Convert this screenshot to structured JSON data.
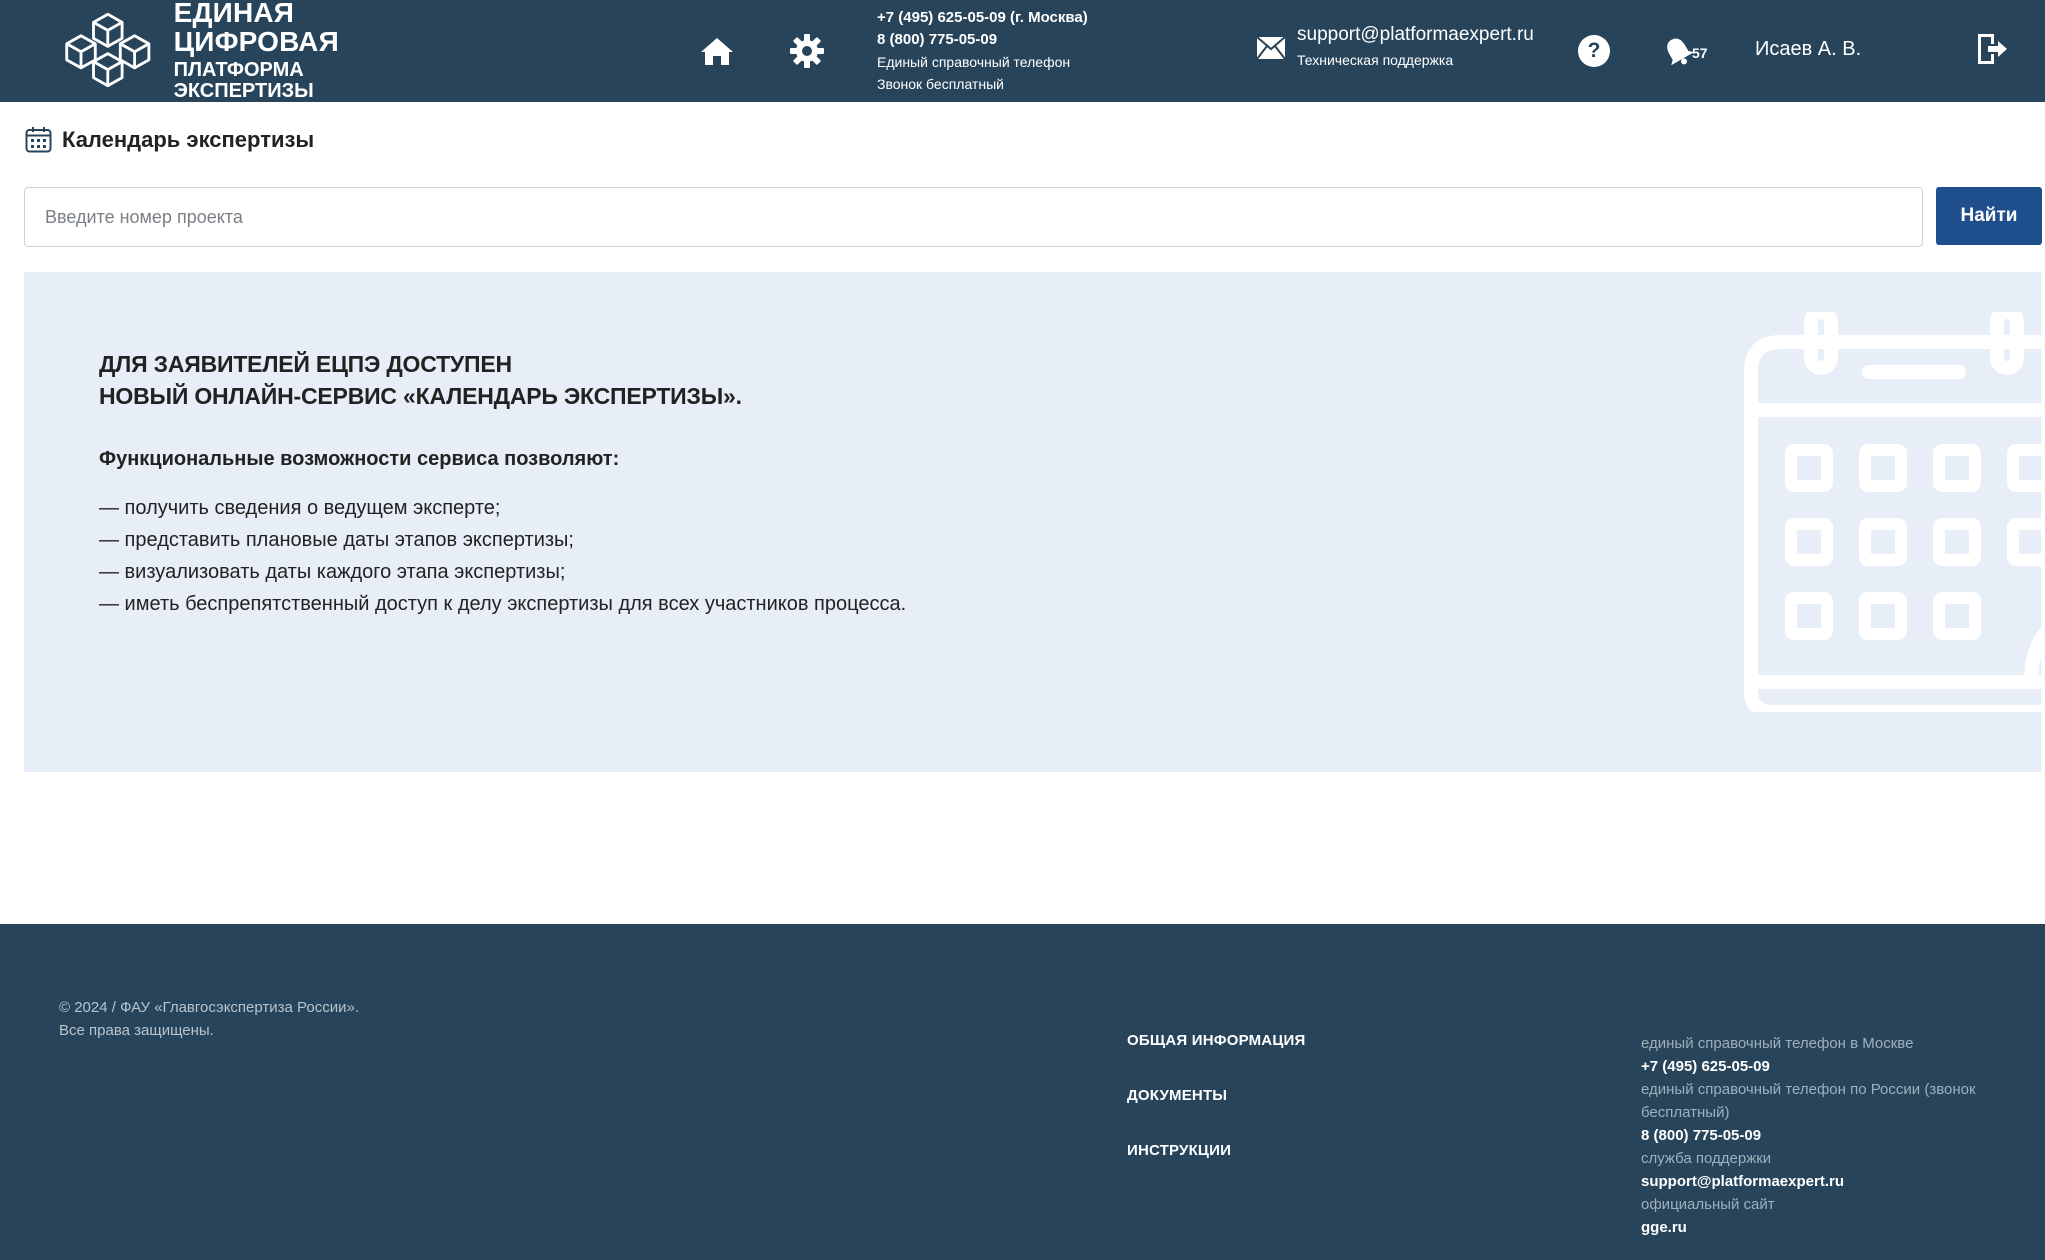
{
  "header": {
    "logo_line1": "ЕДИНАЯ ЦИФРОВАЯ",
    "logo_line2": "ПЛАТФОРМА ЭКСПЕРТИЗЫ",
    "phone_moscow": "+7 (495) 625-05-09 (г. Москва)",
    "phone_free": "8 (800) 775-05-09",
    "phone_label": "Единый справочный телефон",
    "phone_free_label": "Звонок бесплатный",
    "support_email": "support@platformaexpert.ru",
    "support_label": "Техническая поддержка",
    "help_glyph": "?",
    "notifications_count": "57",
    "user_name": "Исаев А. В.",
    "icons": [
      "home-icon",
      "gear-icon",
      "mail-icon",
      "help-icon",
      "bell-icon",
      "logout-icon"
    ]
  },
  "page": {
    "title": "Календарь экспертизы",
    "title_icon": "calendar-icon"
  },
  "search": {
    "placeholder": "Введите номер проекта",
    "value": "",
    "button_label": "Найти"
  },
  "banner": {
    "heading_line1": "ДЛЯ ЗАЯВИТЕЛЕЙ ЕЦПЭ ДОСТУПЕН",
    "heading_line2": "НОВЫЙ ОНЛАЙН-СЕРВИС «КАЛЕНДАРЬ ЭКСПЕРТИЗЫ».",
    "features_intro": "Функциональные возможности сервиса позволяют:",
    "features": [
      "— получить сведения о ведущем эксперте;",
      "— представить плановые даты этапов экспертизы;",
      "— визуализовать даты каждого этапа экспертизы;",
      "— иметь беспрепятственный доступ к делу экспертизы для всех участников процесса."
    ],
    "illustration": "calendar-icon"
  },
  "footer": {
    "copyright_line1": "© 2024 / ФАУ «Главгосэкспертиза России».",
    "copyright_line2": "Все права защищены.",
    "links": [
      "ОБЩАЯ ИНФОРМАЦИЯ",
      "ДОКУМЕНТЫ",
      "ИНСТРУКЦИИ"
    ],
    "contacts": [
      {
        "label": "единый справочный телефон в Москве",
        "value": "+7 (495) 625-05-09"
      },
      {
        "label": "единый справочный телефон по России (звонок бесплатный)",
        "value": "8 (800) 775-05-09"
      },
      {
        "label": "служба поддержки",
        "value": "support@platformaexpert.ru"
      },
      {
        "label": "официальный сайт",
        "value": "gge.ru"
      }
    ]
  },
  "colors": {
    "header_bg": "#27445a",
    "footer_bg": "#27445a",
    "accent_button": "#1f4e8c",
    "banner_bg": "#e7eef7"
  }
}
